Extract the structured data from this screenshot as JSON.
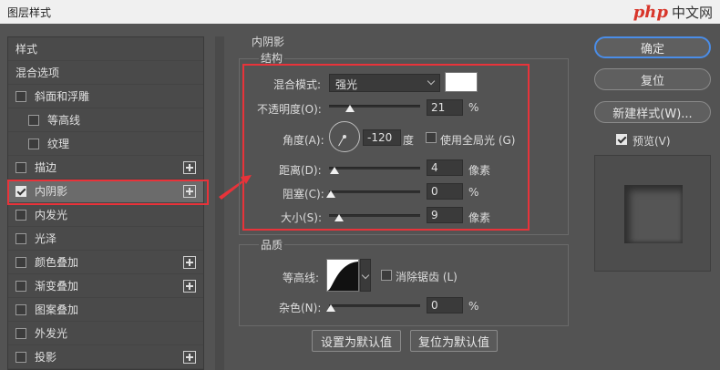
{
  "window": {
    "title": "图层样式"
  },
  "brand": {
    "logo": "php",
    "site": "中文网"
  },
  "style_list": [
    {
      "label": "样式",
      "checkbox": false,
      "checked": false,
      "plus": false,
      "indent": false,
      "active": false
    },
    {
      "label": "混合选项",
      "checkbox": false,
      "checked": false,
      "plus": false,
      "indent": false,
      "active": false
    },
    {
      "label": "斜面和浮雕",
      "checkbox": true,
      "checked": false,
      "plus": false,
      "indent": false,
      "active": false
    },
    {
      "label": "等高线",
      "checkbox": true,
      "checked": false,
      "plus": false,
      "indent": true,
      "active": false
    },
    {
      "label": "纹理",
      "checkbox": true,
      "checked": false,
      "plus": false,
      "indent": true,
      "active": false
    },
    {
      "label": "描边",
      "checkbox": true,
      "checked": false,
      "plus": true,
      "indent": false,
      "active": false
    },
    {
      "label": "内阴影",
      "checkbox": true,
      "checked": true,
      "plus": true,
      "indent": false,
      "active": true
    },
    {
      "label": "内发光",
      "checkbox": true,
      "checked": false,
      "plus": false,
      "indent": false,
      "active": false
    },
    {
      "label": "光泽",
      "checkbox": true,
      "checked": false,
      "plus": false,
      "indent": false,
      "active": false
    },
    {
      "label": "颜色叠加",
      "checkbox": true,
      "checked": false,
      "plus": true,
      "indent": false,
      "active": false
    },
    {
      "label": "渐变叠加",
      "checkbox": true,
      "checked": false,
      "plus": true,
      "indent": false,
      "active": false
    },
    {
      "label": "图案叠加",
      "checkbox": true,
      "checked": false,
      "plus": false,
      "indent": false,
      "active": false
    },
    {
      "label": "外发光",
      "checkbox": true,
      "checked": false,
      "plus": false,
      "indent": false,
      "active": false
    },
    {
      "label": "投影",
      "checkbox": true,
      "checked": false,
      "plus": true,
      "indent": false,
      "active": false
    }
  ],
  "panel": {
    "title": "内阴影",
    "structure": {
      "title": "结构",
      "blend_mode_label": "混合模式:",
      "blend_mode_value": "强光",
      "swatch_color": "#ffffff",
      "opacity_label": "不透明度(O):",
      "opacity_value": "21",
      "opacity_unit": "%",
      "opacity_fraction": 0.21,
      "angle_label": "角度(A):",
      "angle_value": "-120",
      "angle_unit": "度",
      "angle_degrees": -120,
      "global_light_label": "使用全局光 (G)",
      "global_light_checked": false,
      "distance_label": "距离(D):",
      "distance_value": "4",
      "distance_unit": "像素",
      "distance_fraction": 0.04,
      "choke_label": "阻塞(C):",
      "choke_value": "0",
      "choke_unit": "%",
      "choke_fraction": 0,
      "size_label": "大小(S):",
      "size_value": "9",
      "size_unit": "像素",
      "size_fraction": 0.09
    },
    "quality": {
      "title": "品质",
      "contour_label": "等高线:",
      "antialias_label": "消除锯齿 (L)",
      "antialias_checked": false,
      "noise_label": "杂色(N):",
      "noise_value": "0",
      "noise_unit": "%",
      "noise_fraction": 0
    },
    "set_default_label": "设置为默认值",
    "reset_default_label": "复位为默认值"
  },
  "buttons": {
    "ok": "确定",
    "reset": "复位",
    "new_style": "新建样式(W)...",
    "preview_label": "预览(V)",
    "preview_checked": true
  },
  "colors": {
    "highlight": "#e8333a",
    "focus": "#4a8de8"
  }
}
